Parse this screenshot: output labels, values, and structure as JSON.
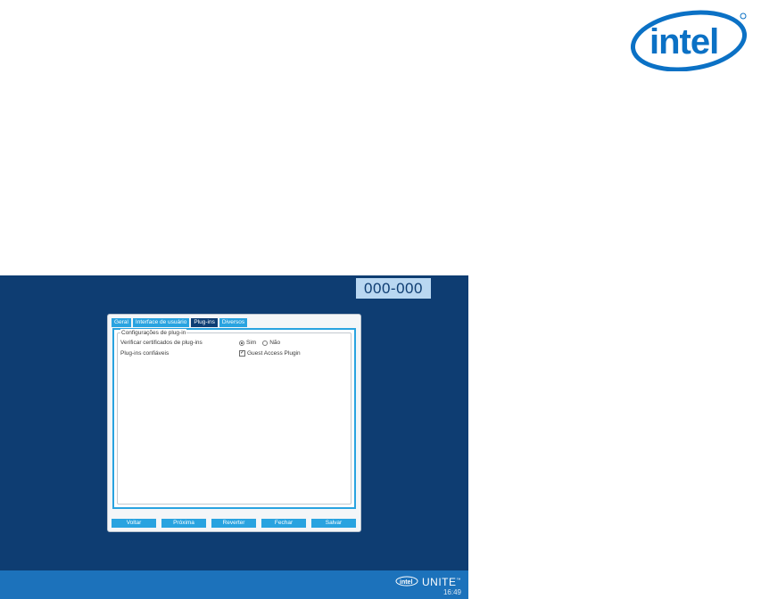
{
  "logo": {
    "text": "intel",
    "icon": "intel-logo"
  },
  "screen": {
    "pin_code": "000-000",
    "tabs": [
      {
        "label": "Geral",
        "active": false
      },
      {
        "label": "Interface de usuário",
        "active": false
      },
      {
        "label": "Plug-ins",
        "active": true
      },
      {
        "label": "Diversos",
        "active": false
      }
    ],
    "group_title": "Configurações de plug-in",
    "rows": [
      {
        "label": "Verificar certificados de plug-ins",
        "options": [
          "Sim",
          "Não"
        ],
        "selected": "Sim"
      },
      {
        "label": "Plug-ins confiáveis",
        "checkbox_label": "Guest Access Plugin",
        "checked": true
      }
    ],
    "buttons": [
      "Voltar",
      "Próxima",
      "Reverter",
      "Fechar",
      "Salvar"
    ],
    "brand": {
      "intel": "intel",
      "product": "UNITE",
      "trademark": "™"
    },
    "clock": "16:49"
  },
  "colors": {
    "background": "#0e3d72",
    "accent": "#29a3e0",
    "active_tab": "#0d3e74",
    "bottom_bar": "#1c72bb"
  }
}
